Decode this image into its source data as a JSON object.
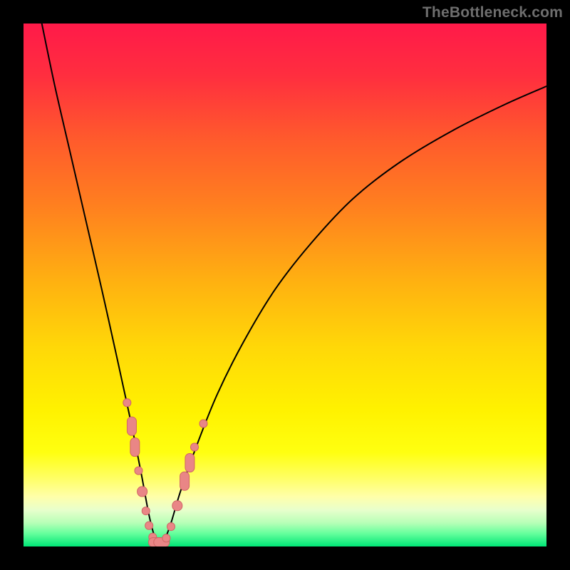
{
  "watermark": {
    "text": "TheBottleneck.com"
  },
  "gradient": {
    "stops": [
      {
        "offset": 0,
        "color": "#ff1a49"
      },
      {
        "offset": 0.1,
        "color": "#ff2e3f"
      },
      {
        "offset": 0.22,
        "color": "#ff5a2c"
      },
      {
        "offset": 0.35,
        "color": "#ff801f"
      },
      {
        "offset": 0.5,
        "color": "#ffb310"
      },
      {
        "offset": 0.62,
        "color": "#ffd808"
      },
      {
        "offset": 0.74,
        "color": "#fff200"
      },
      {
        "offset": 0.82,
        "color": "#ffff10"
      },
      {
        "offset": 0.87,
        "color": "#ffff66"
      },
      {
        "offset": 0.905,
        "color": "#ffffaa"
      },
      {
        "offset": 0.93,
        "color": "#e8ffcc"
      },
      {
        "offset": 0.955,
        "color": "#b7ffb7"
      },
      {
        "offset": 0.975,
        "color": "#66ff9d"
      },
      {
        "offset": 1.0,
        "color": "#00e676"
      }
    ]
  },
  "chart_data": {
    "type": "line",
    "title": "",
    "xlabel": "",
    "ylabel": "",
    "x_range": [
      0,
      100
    ],
    "y_range": [
      0,
      100
    ],
    "notes": "Bottleneck-style V-curve. X is a component scale (0–100), Y is bottleneck % (0 = ideal match at green bottom, 100 = severe). Minimum sits near x ≈ 25. Left branch descends steeply from top-left; right branch rises with long tail toward top-right. Salmon markers cluster near the valley region on both branches.",
    "series": [
      {
        "name": "bottleneck-curve",
        "x": [
          3.5,
          6,
          9,
          12,
          15,
          18,
          20.5,
          22.5,
          24,
          25.2,
          26,
          27,
          28.2,
          30,
          33,
          37,
          42,
          48,
          55,
          63,
          72,
          82,
          92,
          100
        ],
        "y": [
          100,
          88,
          75,
          62,
          49,
          35.5,
          24,
          14,
          6,
          1.5,
          0.5,
          1.4,
          4.5,
          10.5,
          19,
          29,
          39,
          49,
          58,
          66.5,
          73.5,
          79.5,
          84.5,
          88
        ]
      }
    ],
    "markers": {
      "name": "sample-points",
      "shape": "rounded-rect",
      "color": "#e98686",
      "points": [
        {
          "x": 19.8,
          "y": 27.5,
          "size": "s"
        },
        {
          "x": 20.7,
          "y": 23.0,
          "size": "m",
          "tall": true
        },
        {
          "x": 21.3,
          "y": 19.0,
          "size": "m",
          "tall": true
        },
        {
          "x": 22.0,
          "y": 14.5,
          "size": "s"
        },
        {
          "x": 22.7,
          "y": 10.5,
          "size": "m"
        },
        {
          "x": 23.4,
          "y": 6.8,
          "size": "s"
        },
        {
          "x": 24.0,
          "y": 4.0,
          "size": "s"
        },
        {
          "x": 24.7,
          "y": 1.8,
          "size": "s"
        },
        {
          "x": 25.4,
          "y": 0.8,
          "size": "m",
          "wide": true
        },
        {
          "x": 26.4,
          "y": 0.8,
          "size": "m",
          "wide": true
        },
        {
          "x": 27.3,
          "y": 1.6,
          "size": "s"
        },
        {
          "x": 28.2,
          "y": 3.8,
          "size": "s"
        },
        {
          "x": 29.4,
          "y": 7.8,
          "size": "m"
        },
        {
          "x": 30.8,
          "y": 12.5,
          "size": "m",
          "tall": true
        },
        {
          "x": 31.8,
          "y": 16.0,
          "size": "m",
          "tall": true
        },
        {
          "x": 32.7,
          "y": 19.0,
          "size": "s"
        },
        {
          "x": 34.4,
          "y": 23.5,
          "size": "s"
        }
      ]
    }
  }
}
